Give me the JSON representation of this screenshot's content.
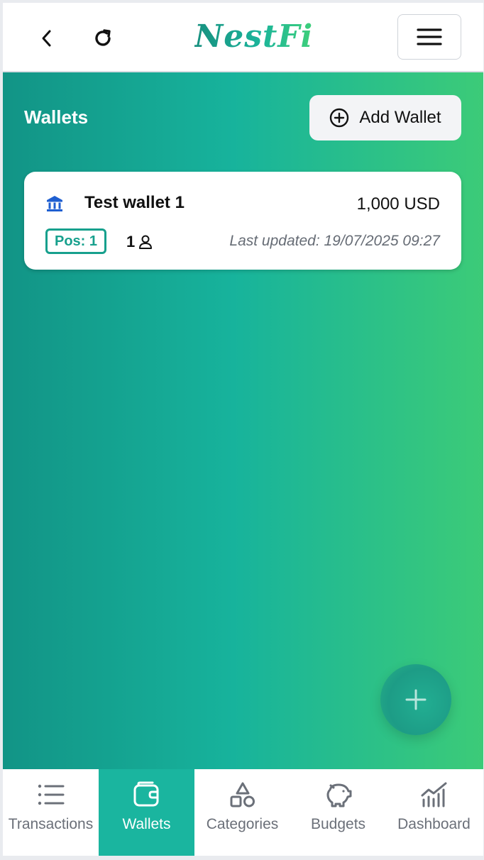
{
  "header": {
    "brand": "NestFi",
    "icons": {
      "back": "chevron-left-icon",
      "reload": "reload-icon",
      "menu": "hamburger-menu-icon"
    }
  },
  "main": {
    "title": "Wallets",
    "add_wallet_label": "Add Wallet",
    "wallets": [
      {
        "name": "Test wallet 1",
        "amount": "1,000 USD",
        "position_badge": "Pos: 1",
        "members_count": "1",
        "last_updated": "Last updated: 19/07/2025 09:27",
        "icon": "bank-icon"
      }
    ]
  },
  "bottom_nav": {
    "items": [
      {
        "label": "Transactions",
        "icon": "list-icon",
        "active": false
      },
      {
        "label": "Wallets",
        "icon": "wallet-icon",
        "active": true
      },
      {
        "label": "Categories",
        "icon": "shapes-icon",
        "active": false
      },
      {
        "label": "Budgets",
        "icon": "piggy-bank-icon",
        "active": false
      },
      {
        "label": "Dashboard",
        "icon": "chart-icon",
        "active": false
      }
    ]
  },
  "colors": {
    "brand_teal": "#1ab59f",
    "gradient_start": "#129486",
    "gradient_end": "#3ccb78",
    "badge": "#17a08d",
    "bank_icon": "#1f5fd1"
  }
}
